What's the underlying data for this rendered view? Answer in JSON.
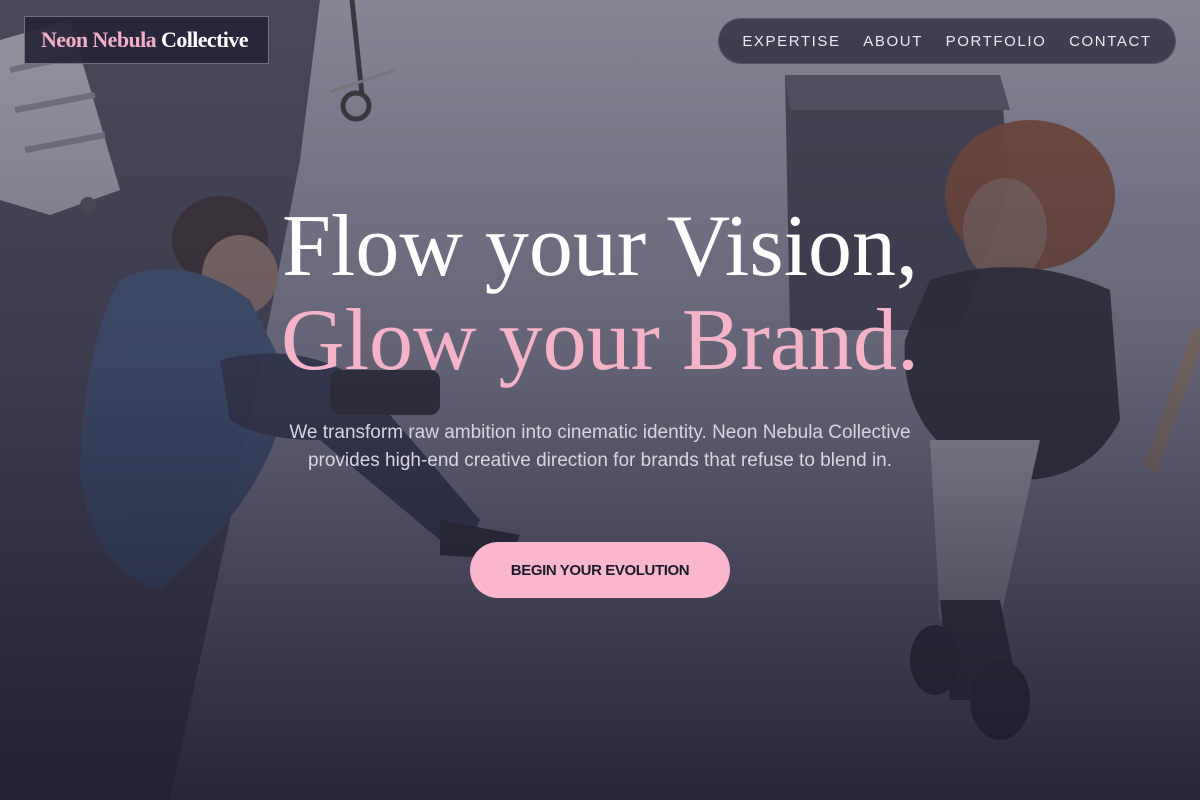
{
  "header": {
    "logo": {
      "part1": "Neon Nebula",
      "part2": "Collective"
    },
    "nav": [
      {
        "label": "EXPERTISE"
      },
      {
        "label": "ABOUT"
      },
      {
        "label": "PORTFOLIO"
      },
      {
        "label": "CONTACT"
      }
    ]
  },
  "hero": {
    "headline_line1": "Flow your Vision,",
    "headline_line2": "Glow your Brand.",
    "subtitle": "We transform raw ambition into cinematic identity. Neon Nebula Collective provides high-end creative direction for brands that refuse to blend in.",
    "cta_label": "BEGIN YOUR EVOLUTION"
  },
  "colors": {
    "accent_pink": "#f5b3ca",
    "button_bg": "#f9b6cc",
    "overlay_dark": "#1e1c2e"
  }
}
